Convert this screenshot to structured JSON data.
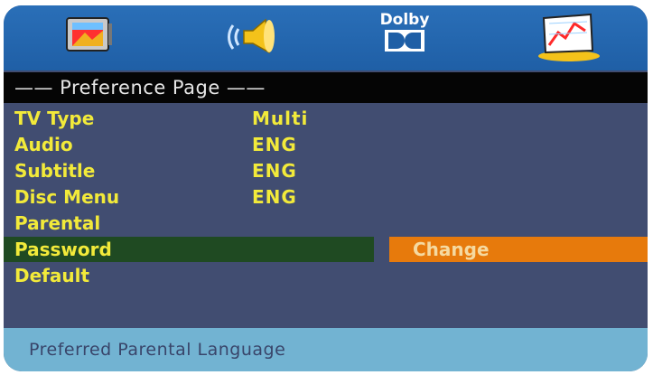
{
  "toolbar": {
    "icons": [
      "tv-setup-icon",
      "audio-speaker-icon",
      "dolby-icon",
      "video-settings-icon"
    ],
    "dolby_label": "Dolby"
  },
  "page_title": "—— Preference Page ——",
  "menu": [
    {
      "label": "TV Type",
      "value": "Multi"
    },
    {
      "label": "Audio",
      "value": "ENG"
    },
    {
      "label": "Subtitle",
      "value": "ENG"
    },
    {
      "label": "Disc Menu",
      "value": "ENG"
    },
    {
      "label": "Parental",
      "value": ""
    },
    {
      "label": "Password",
      "value": "",
      "selected": true
    },
    {
      "label": "Default",
      "value": ""
    }
  ],
  "submenu": {
    "change_label": "Change"
  },
  "status_text": "Preferred Parental Language",
  "colors": {
    "topbar": "#2a6fb8",
    "body": "#414d71",
    "title_bg": "#050505",
    "menu_text": "#f2ea3a",
    "selection": "#1f4a22",
    "highlight": "#e77a0c",
    "status_bg": "#72b3d2"
  }
}
